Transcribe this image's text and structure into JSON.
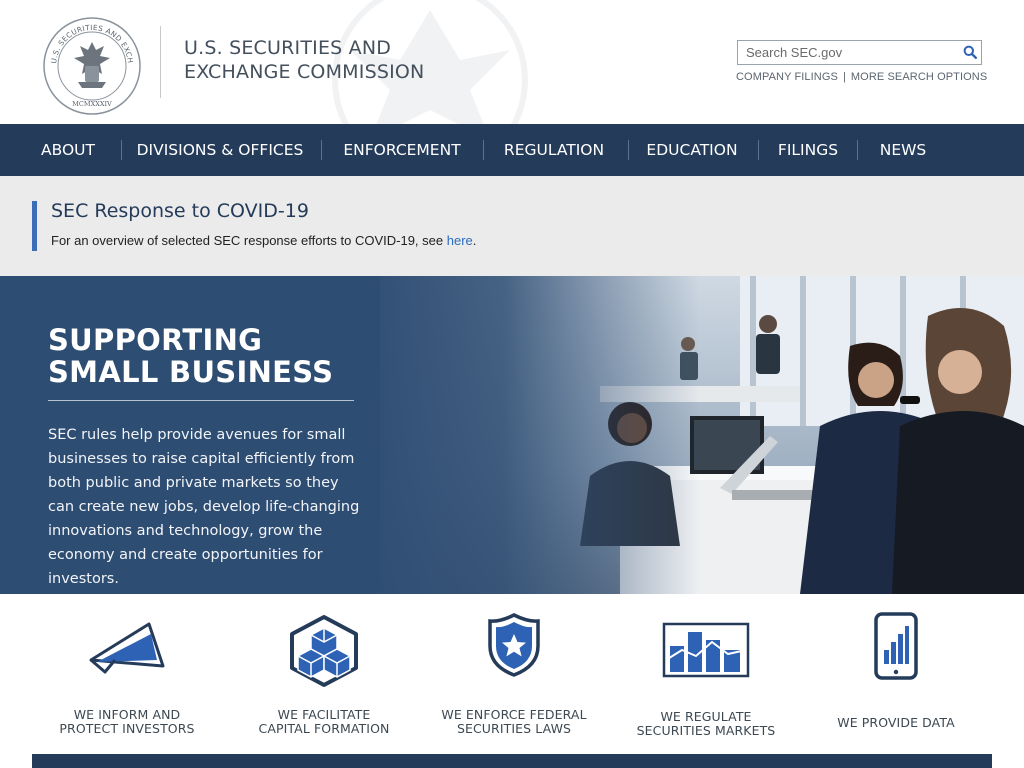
{
  "header": {
    "agency_line1": "U.S. SECURITIES AND",
    "agency_line2": "EXCHANGE COMMISSION",
    "seal_text": "U.S. SECURITIES AND EXCHANGE COMMISSION",
    "seal_year": "MCMXXXIV",
    "search": {
      "placeholder": "Search SEC.gov",
      "value": ""
    },
    "links": [
      "COMPANY FILINGS",
      "MORE SEARCH OPTIONS"
    ]
  },
  "nav": {
    "items": [
      "ABOUT",
      "DIVISIONS & OFFICES",
      "ENFORCEMENT",
      "REGULATION",
      "EDUCATION",
      "FILINGS",
      "NEWS"
    ]
  },
  "notice": {
    "title": "SEC Response to COVID-19",
    "text": "For an overview of selected SEC response efforts to COVID-19, see ",
    "link": "here",
    "after_link": "."
  },
  "hero": {
    "heading": "SUPPORTING SMALL BUSINESS",
    "text": "SEC rules help provide avenues for small businesses to raise capital efficiently from both public and private markets so they can create new jobs, develop life-changing innovations and technology, grow the economy and create opportunities for investors."
  },
  "tiles": [
    {
      "line1": "WE INFORM AND",
      "line2": "PROTECT INVESTORS",
      "icon": "megaphone-icon"
    },
    {
      "line1": "WE FACILITATE",
      "line2": "CAPITAL FORMATION",
      "icon": "cubes-icon"
    },
    {
      "line1": "WE ENFORCE FEDERAL",
      "line2": "SECURITIES LAWS",
      "icon": "shield-star-icon"
    },
    {
      "line1": "WE REGULATE",
      "line2": "SECURITIES MARKETS",
      "icon": "bar-chart-icon"
    },
    {
      "line1": "WE PROVIDE DATA",
      "line2": "",
      "icon": "mobile-chart-icon"
    }
  ],
  "colors": {
    "navy": "#243b5a",
    "hero_blue": "#2e4d73",
    "link_blue": "#2a6cbf",
    "icon_blue": "#2d62b5",
    "accent_bar": "#3b6db8"
  }
}
